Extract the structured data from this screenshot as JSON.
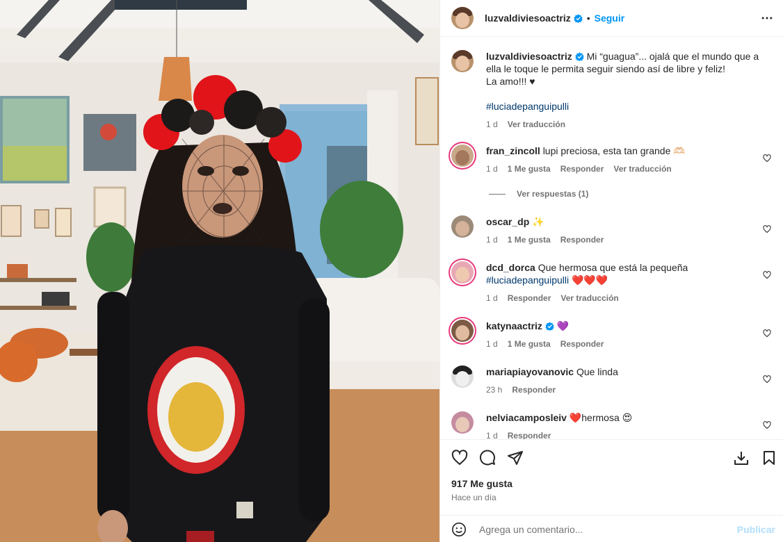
{
  "post": {
    "username": "luzvaldiviesoactriz",
    "separator": "•",
    "follow_label": "Seguir",
    "caption": {
      "line1": "Mi “guagua”... ojalá que el mundo que a",
      "line2": "ella le toque le permita seguir siendo así de libre y feliz!",
      "line3": "La amo!!! ♥",
      "hashtag": "#luciadepanguipulli",
      "age": "1 d",
      "translate": "Ver traducción"
    }
  },
  "comments": [
    {
      "username": "fran_zincoll",
      "text": "lupi preciosa, esta tan grande 🫶🏻",
      "age": "1 d",
      "likes": "1 Me gusta",
      "reply": "Responder",
      "translate": "Ver traducción"
    },
    {
      "username": "oscar_dp",
      "text": "✨",
      "age": "1 d",
      "likes": "1 Me gusta",
      "reply": "Responder"
    },
    {
      "username": "dcd_dorca",
      "text": "Que hermosa que está la pequeña",
      "hashtag": "#luciadepanguipulli",
      "emojis": "❤️❤️❤️",
      "age": "1 d",
      "reply": "Responder",
      "translate": "Ver traducción"
    },
    {
      "username": "katynaactriz",
      "text": "💜",
      "age": "1 d",
      "likes": "1 Me gusta",
      "reply": "Responder"
    },
    {
      "username": "mariapiayovanovic",
      "text": "Que linda",
      "age": "23 h",
      "reply": "Responder"
    },
    {
      "username": "nelviacamposleiv",
      "text": "❤️hermosa 😍",
      "age": "1 d",
      "reply": "Responder"
    }
  ],
  "replies_label": "Ver respuestas (1)",
  "footer": {
    "likes": "917 Me gusta",
    "time": "Hace un día",
    "comment_placeholder": "Agrega un comentario...",
    "publish_label": "Publicar"
  },
  "colors": {
    "accent": "#0095f6",
    "verified": "#0095f6",
    "story_ring": "#e6387a",
    "muted": "#737373"
  },
  "icons": [
    "more-options-icon",
    "verified-badge-icon",
    "heart-icon",
    "comment-icon",
    "share-icon",
    "download-icon",
    "bookmark-icon",
    "emoji-icon"
  ]
}
